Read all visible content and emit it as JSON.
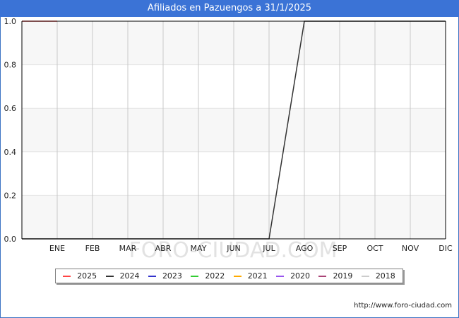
{
  "title": "Afiliados en Pazuengos a 31/1/2025",
  "source": "http://www.foro-ciudad.com",
  "watermark": "FORO-CIUDAD.COM",
  "chart_data": {
    "type": "line",
    "categories": [
      "ENE",
      "FEB",
      "MAR",
      "ABR",
      "MAY",
      "JUN",
      "JUL",
      "AGO",
      "SEP",
      "OCT",
      "NOV",
      "DIC"
    ],
    "ylim": [
      0,
      1.0
    ],
    "yticks": [
      "0.0",
      "0.2",
      "0.4",
      "0.6",
      "0.8",
      "1.0"
    ],
    "grid": true,
    "legend_position": "bottom",
    "series": [
      {
        "name": "2025",
        "color": "#ff4444",
        "values": [
          1,
          null,
          null,
          null,
          null,
          null,
          null,
          null,
          null,
          null,
          null,
          null
        ]
      },
      {
        "name": "2024",
        "color": "#333333",
        "values": [
          0,
          0,
          0,
          0,
          0,
          0,
          0,
          1,
          1,
          1,
          1,
          1
        ]
      },
      {
        "name": "2023",
        "color": "#3333cc",
        "values": []
      },
      {
        "name": "2022",
        "color": "#33cc33",
        "values": []
      },
      {
        "name": "2021",
        "color": "#ffaa00",
        "values": []
      },
      {
        "name": "2020",
        "color": "#9955ee",
        "values": []
      },
      {
        "name": "2019",
        "color": "#aa4477",
        "values": []
      },
      {
        "name": "2018",
        "color": "#cccccc",
        "values": []
      }
    ]
  }
}
